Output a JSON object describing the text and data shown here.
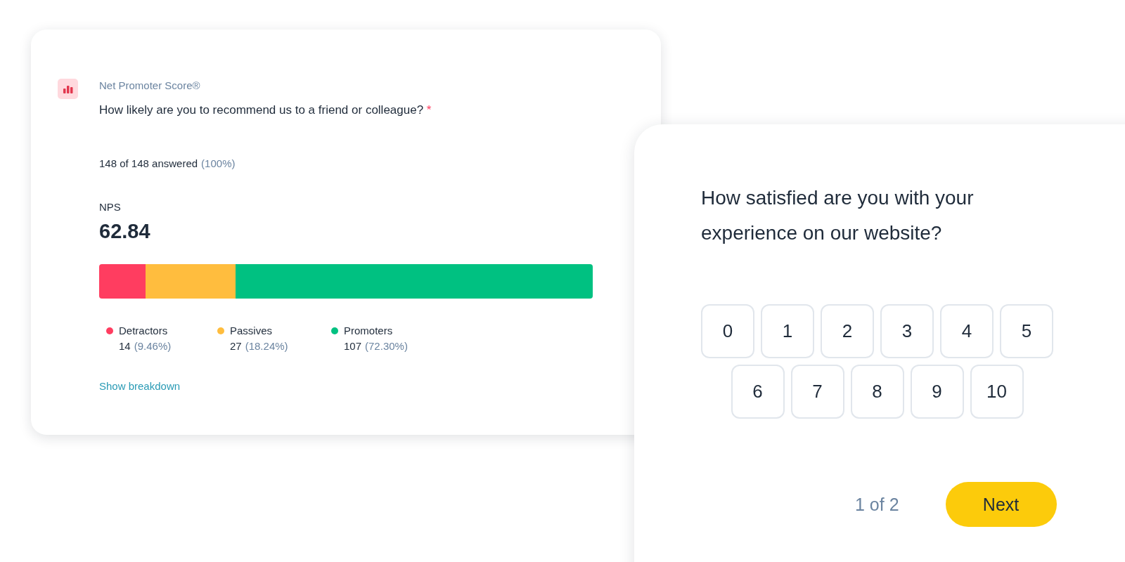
{
  "report_card": {
    "category": "Net Promoter Score®",
    "question": "How likely are you to recommend us to a friend or colleague?",
    "required_mark": "*",
    "answered": "148 of 148 answered",
    "answered_percent": "(100%)",
    "score_label": "NPS",
    "score": "62.84",
    "groups": [
      {
        "label": "Detractors",
        "count": "14",
        "percent": "(9.46%)",
        "color": "#ff3d60",
        "level": 0.0946
      },
      {
        "label": "Passives",
        "count": "27",
        "percent": "(18.24%)",
        "color": "#ffbd3e",
        "level": 0.1824
      },
      {
        "label": "Promoters",
        "count": "107",
        "percent": "(72.30%)",
        "color": "#00c181",
        "level": 0.723
      }
    ],
    "link": "Show breakdown"
  },
  "survey_card": {
    "question": "How satisfied are you with your experience on our website?",
    "scale_rows": [
      [
        {
          "label": "0",
          "selected": false
        },
        {
          "label": "1",
          "selected": false
        },
        {
          "label": "2",
          "selected": false
        },
        {
          "label": "3",
          "selected": false
        },
        {
          "label": "4",
          "selected": false
        },
        {
          "label": "5",
          "selected": false
        }
      ],
      [
        {
          "label": "6",
          "selected": false
        },
        {
          "label": "7",
          "selected": false
        },
        {
          "label": "8",
          "selected": false
        },
        {
          "label": "9",
          "selected": false
        },
        {
          "label": "10",
          "selected": false
        }
      ]
    ],
    "progress": "1 of 2",
    "next_button": "Next"
  }
}
